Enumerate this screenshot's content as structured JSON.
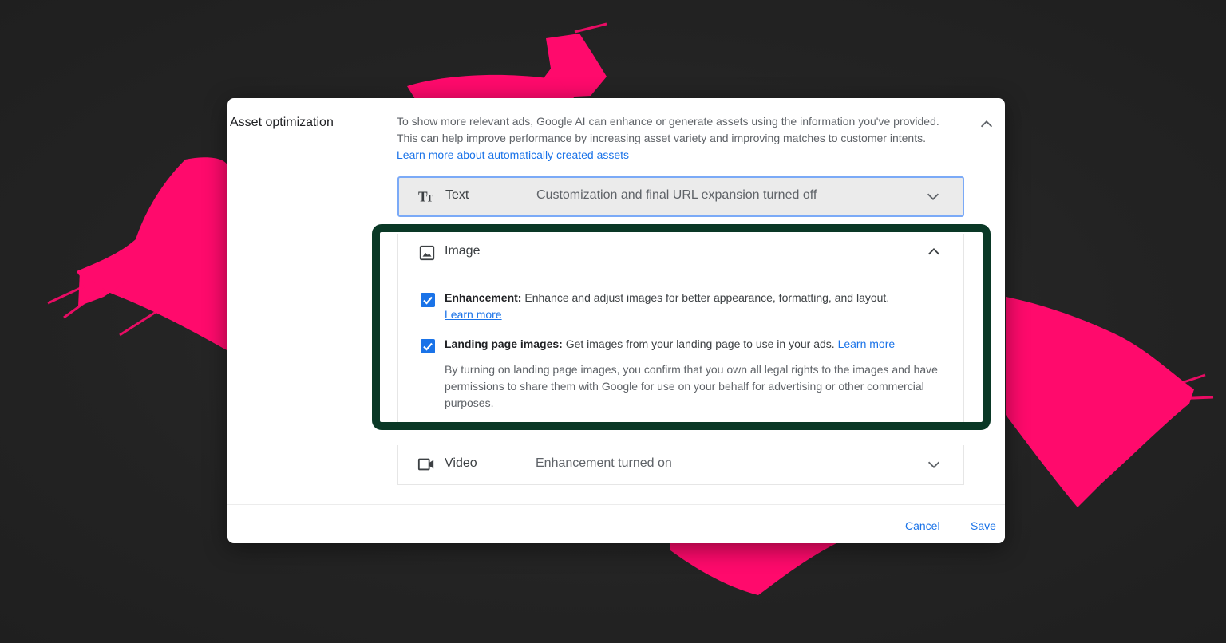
{
  "section_title": "Asset optimization",
  "intro": {
    "text": "To show more relevant ads, Google AI can enhance or generate assets using the information you've provided. This can help improve performance by increasing asset variety and improving matches to customer intents.",
    "link": "Learn more about automatically created assets"
  },
  "rows": {
    "text": {
      "icon": "text-format-icon",
      "label": "Text",
      "status": "Customization and final URL expansion turned off"
    },
    "image": {
      "icon": "image-icon",
      "label": "Image"
    },
    "video": {
      "icon": "video-camera-icon",
      "label": "Video",
      "status": "Enhancement turned on"
    }
  },
  "image_options": {
    "enhancement": {
      "title": "Enhancement:",
      "text": "Enhance and adjust images for better appearance, formatting, and layout.",
      "link": "Learn more",
      "checked": true
    },
    "landing_page": {
      "title": "Landing page images:",
      "text": "Get images from your landing page to use in your ads.",
      "link": "Learn more",
      "checked": true,
      "note": "By turning on landing page images, you confirm that you own all legal rights to the images and have permissions to share them with Google for use on your behalf for advertising or other commercial purposes."
    }
  },
  "buttons": {
    "cancel": "Cancel",
    "save": "Save"
  },
  "colors": {
    "accent": "#1a73e8",
    "highlight": "#0a3826",
    "brush": "#ff0a6c"
  }
}
